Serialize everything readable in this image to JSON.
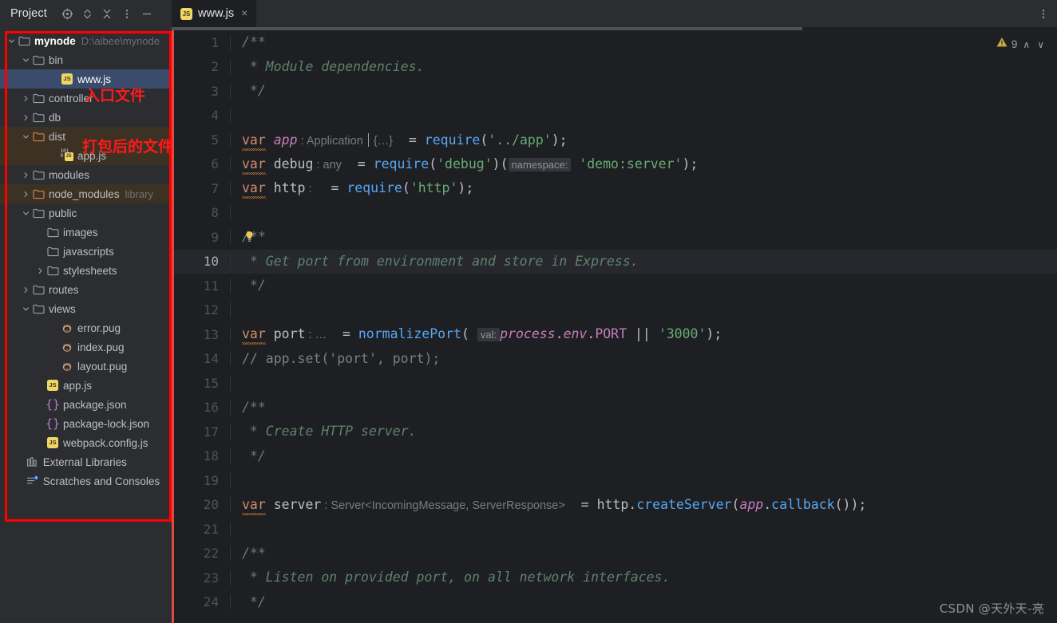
{
  "window": {
    "panel_title": "Project",
    "panel_icons": [
      {
        "name": "locate-target-icon",
        "label": "Select Opened File"
      },
      {
        "name": "expand-collapse-icon",
        "label": "Expand / Collapse"
      },
      {
        "name": "collapse-all-icon",
        "label": "Collapse All"
      },
      {
        "name": "more-options-icon",
        "label": "Options"
      },
      {
        "name": "minimize-icon",
        "label": "Hide"
      }
    ],
    "main_menu_icon": "more-vertical-icon"
  },
  "tabs": [
    {
      "label": "www.js",
      "icon": "js-file-icon",
      "close": "×",
      "active": true
    }
  ],
  "sidebar": {
    "annotations": [
      {
        "name": "entry-file-annotation",
        "text": "入口文件"
      },
      {
        "name": "packed-files-annotation",
        "text": "打包后的文件"
      }
    ],
    "annotation_color": "#ff0000",
    "items": [
      {
        "label": "mynode",
        "path": "D:\\aibee\\mynode",
        "indent": 0,
        "icon": "folder-icon",
        "arrow": "down",
        "kind": "root"
      },
      {
        "label": "bin",
        "indent": 1,
        "icon": "folder-icon",
        "arrow": "down",
        "kind": "folder"
      },
      {
        "label": "www.js",
        "indent": 3,
        "icon": "js-file-icon",
        "arrow": "none",
        "kind": "file",
        "state": "selected"
      },
      {
        "label": "controller",
        "indent": 1,
        "icon": "folder-icon",
        "arrow": "right",
        "kind": "folder"
      },
      {
        "label": "db",
        "indent": 1,
        "icon": "folder-icon",
        "arrow": "right",
        "kind": "folder"
      },
      {
        "label": "dist",
        "indent": 1,
        "icon": "folder-excluded-icon",
        "arrow": "down",
        "kind": "folder",
        "state": "excluded"
      },
      {
        "label": "app.js",
        "indent": 3,
        "icon": "js-minified-icon",
        "arrow": "none",
        "kind": "file",
        "state": "excluded"
      },
      {
        "label": "modules",
        "indent": 1,
        "icon": "folder-icon",
        "arrow": "right",
        "kind": "folder"
      },
      {
        "label": "node_modules",
        "tag": "library",
        "indent": 1,
        "icon": "folder-excluded-icon",
        "arrow": "right",
        "kind": "folder",
        "state": "excluded"
      },
      {
        "label": "public",
        "indent": 1,
        "icon": "folder-icon",
        "arrow": "down",
        "kind": "folder"
      },
      {
        "label": "images",
        "indent": 2,
        "icon": "folder-icon",
        "arrow": "none",
        "kind": "folder"
      },
      {
        "label": "javascripts",
        "indent": 2,
        "icon": "folder-icon",
        "arrow": "none",
        "kind": "folder"
      },
      {
        "label": "stylesheets",
        "indent": 2,
        "icon": "folder-icon",
        "arrow": "right",
        "kind": "folder"
      },
      {
        "label": "routes",
        "indent": 1,
        "icon": "folder-icon",
        "arrow": "right",
        "kind": "folder"
      },
      {
        "label": "views",
        "indent": 1,
        "icon": "folder-icon",
        "arrow": "down",
        "kind": "folder"
      },
      {
        "label": "error.pug",
        "indent": 3,
        "icon": "pug-file-icon",
        "arrow": "none",
        "kind": "file"
      },
      {
        "label": "index.pug",
        "indent": 3,
        "icon": "pug-file-icon",
        "arrow": "none",
        "kind": "file"
      },
      {
        "label": "layout.pug",
        "indent": 3,
        "icon": "pug-file-icon",
        "arrow": "none",
        "kind": "file"
      },
      {
        "label": "app.js",
        "indent": 2,
        "icon": "js-file-icon",
        "arrow": "none",
        "kind": "file"
      },
      {
        "label": "package.json",
        "indent": 2,
        "icon": "json-file-icon",
        "arrow": "none",
        "kind": "file"
      },
      {
        "label": "package-lock.json",
        "indent": 2,
        "icon": "json-file-icon",
        "arrow": "none",
        "kind": "file"
      },
      {
        "label": "webpack.config.js",
        "indent": 2,
        "icon": "js-file-icon",
        "arrow": "none",
        "kind": "file"
      },
      {
        "label": "External Libraries",
        "indent": 0.6,
        "icon": "libraries-icon",
        "arrow": "none",
        "kind": "node"
      },
      {
        "label": "Scratches and Consoles",
        "indent": 0.6,
        "icon": "scratches-icon",
        "arrow": "none",
        "kind": "node"
      }
    ]
  },
  "editor": {
    "inspection": {
      "icon": "warning-triangle-icon",
      "count": "9",
      "prev": "∧",
      "next": "∨",
      "color": "#d6b24a"
    },
    "current_line": 10,
    "lines": [
      {
        "n": 1,
        "tokens": [
          {
            "t": "comment",
            "v": "/**"
          }
        ]
      },
      {
        "n": 2,
        "tokens": [
          {
            "t": "comment",
            "v": " * Module dependencies."
          }
        ]
      },
      {
        "n": 3,
        "tokens": [
          {
            "t": "comment",
            "v": " */"
          }
        ]
      },
      {
        "n": 4,
        "tokens": []
      },
      {
        "n": 5,
        "tokens": [
          {
            "t": "kw",
            "v": "var"
          },
          {
            "t": "plain",
            "v": " "
          },
          {
            "t": "var",
            "v": "app"
          },
          {
            "t": "hint",
            "v": " : Application "
          },
          {
            "t": "caret",
            "v": ""
          },
          {
            "t": "hint",
            "v": " {…}"
          },
          {
            "t": "plain",
            "v": "  = "
          },
          {
            "t": "fn",
            "v": "require"
          },
          {
            "t": "plain",
            "v": "("
          },
          {
            "t": "str",
            "v": "'../app'"
          },
          {
            "t": "plain",
            "v": ");"
          }
        ]
      },
      {
        "n": 6,
        "tokens": [
          {
            "t": "kw",
            "v": "var"
          },
          {
            "t": "plain",
            "v": " debug"
          },
          {
            "t": "hint",
            "v": " : any"
          },
          {
            "t": "plain",
            "v": "  = "
          },
          {
            "t": "fn",
            "v": "require"
          },
          {
            "t": "plain",
            "v": "("
          },
          {
            "t": "str",
            "v": "'debug'"
          },
          {
            "t": "plain",
            "v": ")("
          },
          {
            "t": "paramhint",
            "v": "namespace:"
          },
          {
            "t": "plain",
            "v": " "
          },
          {
            "t": "str",
            "v": "'demo:server'"
          },
          {
            "t": "plain",
            "v": ");"
          }
        ]
      },
      {
        "n": 7,
        "tokens": [
          {
            "t": "kw",
            "v": "var"
          },
          {
            "t": "plain",
            "v": " http"
          },
          {
            "t": "hint",
            "v": " : "
          },
          {
            "t": "plain",
            "v": "  = "
          },
          {
            "t": "fn",
            "v": "require"
          },
          {
            "t": "plain",
            "v": "("
          },
          {
            "t": "str",
            "v": "'http'"
          },
          {
            "t": "plain",
            "v": ");"
          }
        ]
      },
      {
        "n": 8,
        "tokens": []
      },
      {
        "n": 9,
        "tokens": [
          {
            "t": "comment",
            "v": "/**"
          }
        ],
        "bulb": true
      },
      {
        "n": 10,
        "tokens": [
          {
            "t": "comment",
            "v": " * Get port from environment and store in Express."
          }
        ]
      },
      {
        "n": 11,
        "tokens": [
          {
            "t": "comment",
            "v": " */"
          }
        ]
      },
      {
        "n": 12,
        "tokens": []
      },
      {
        "n": 13,
        "tokens": [
          {
            "t": "kw",
            "v": "var"
          },
          {
            "t": "plain",
            "v": " port"
          },
          {
            "t": "hint",
            "v": " : …"
          },
          {
            "t": "plain",
            "v": "  = "
          },
          {
            "t": "fn",
            "v": "normalizePort"
          },
          {
            "t": "plain",
            "v": "( "
          },
          {
            "t": "paramhint",
            "v": "val:"
          },
          {
            "t": "prop",
            "v": "process"
          },
          {
            "t": "plain",
            "v": "."
          },
          {
            "t": "prop",
            "v": "env"
          },
          {
            "t": "plain",
            "v": "."
          },
          {
            "t": "const",
            "v": "PORT"
          },
          {
            "t": "plain",
            "v": " || "
          },
          {
            "t": "str",
            "v": "'3000'"
          },
          {
            "t": "plain",
            "v": ");"
          }
        ]
      },
      {
        "n": 14,
        "tokens": [
          {
            "t": "linecmt",
            "v": "// app.set('port', port);"
          }
        ]
      },
      {
        "n": 15,
        "tokens": []
      },
      {
        "n": 16,
        "tokens": [
          {
            "t": "comment",
            "v": "/**"
          }
        ]
      },
      {
        "n": 17,
        "tokens": [
          {
            "t": "comment",
            "v": " * Create HTTP server."
          }
        ]
      },
      {
        "n": 18,
        "tokens": [
          {
            "t": "comment",
            "v": " */"
          }
        ]
      },
      {
        "n": 19,
        "tokens": []
      },
      {
        "n": 20,
        "tokens": [
          {
            "t": "kw",
            "v": "var"
          },
          {
            "t": "plain",
            "v": " server"
          },
          {
            "t": "hint",
            "v": " : Server<IncomingMessage, ServerResponse>"
          },
          {
            "t": "plain",
            "v": "  = http."
          },
          {
            "t": "fn",
            "v": "createServer"
          },
          {
            "t": "plain",
            "v": "("
          },
          {
            "t": "var",
            "v": "app"
          },
          {
            "t": "plain",
            "v": "."
          },
          {
            "t": "fn",
            "v": "callback"
          },
          {
            "t": "plain",
            "v": "());"
          }
        ]
      },
      {
        "n": 21,
        "tokens": []
      },
      {
        "n": 22,
        "tokens": [
          {
            "t": "comment",
            "v": "/**"
          }
        ]
      },
      {
        "n": 23,
        "tokens": [
          {
            "t": "comment",
            "v": " * Listen on provided port, on all network interfaces."
          }
        ]
      },
      {
        "n": 24,
        "tokens": [
          {
            "t": "comment",
            "v": " */"
          }
        ]
      }
    ]
  },
  "watermark": "CSDN @天外天-亮"
}
